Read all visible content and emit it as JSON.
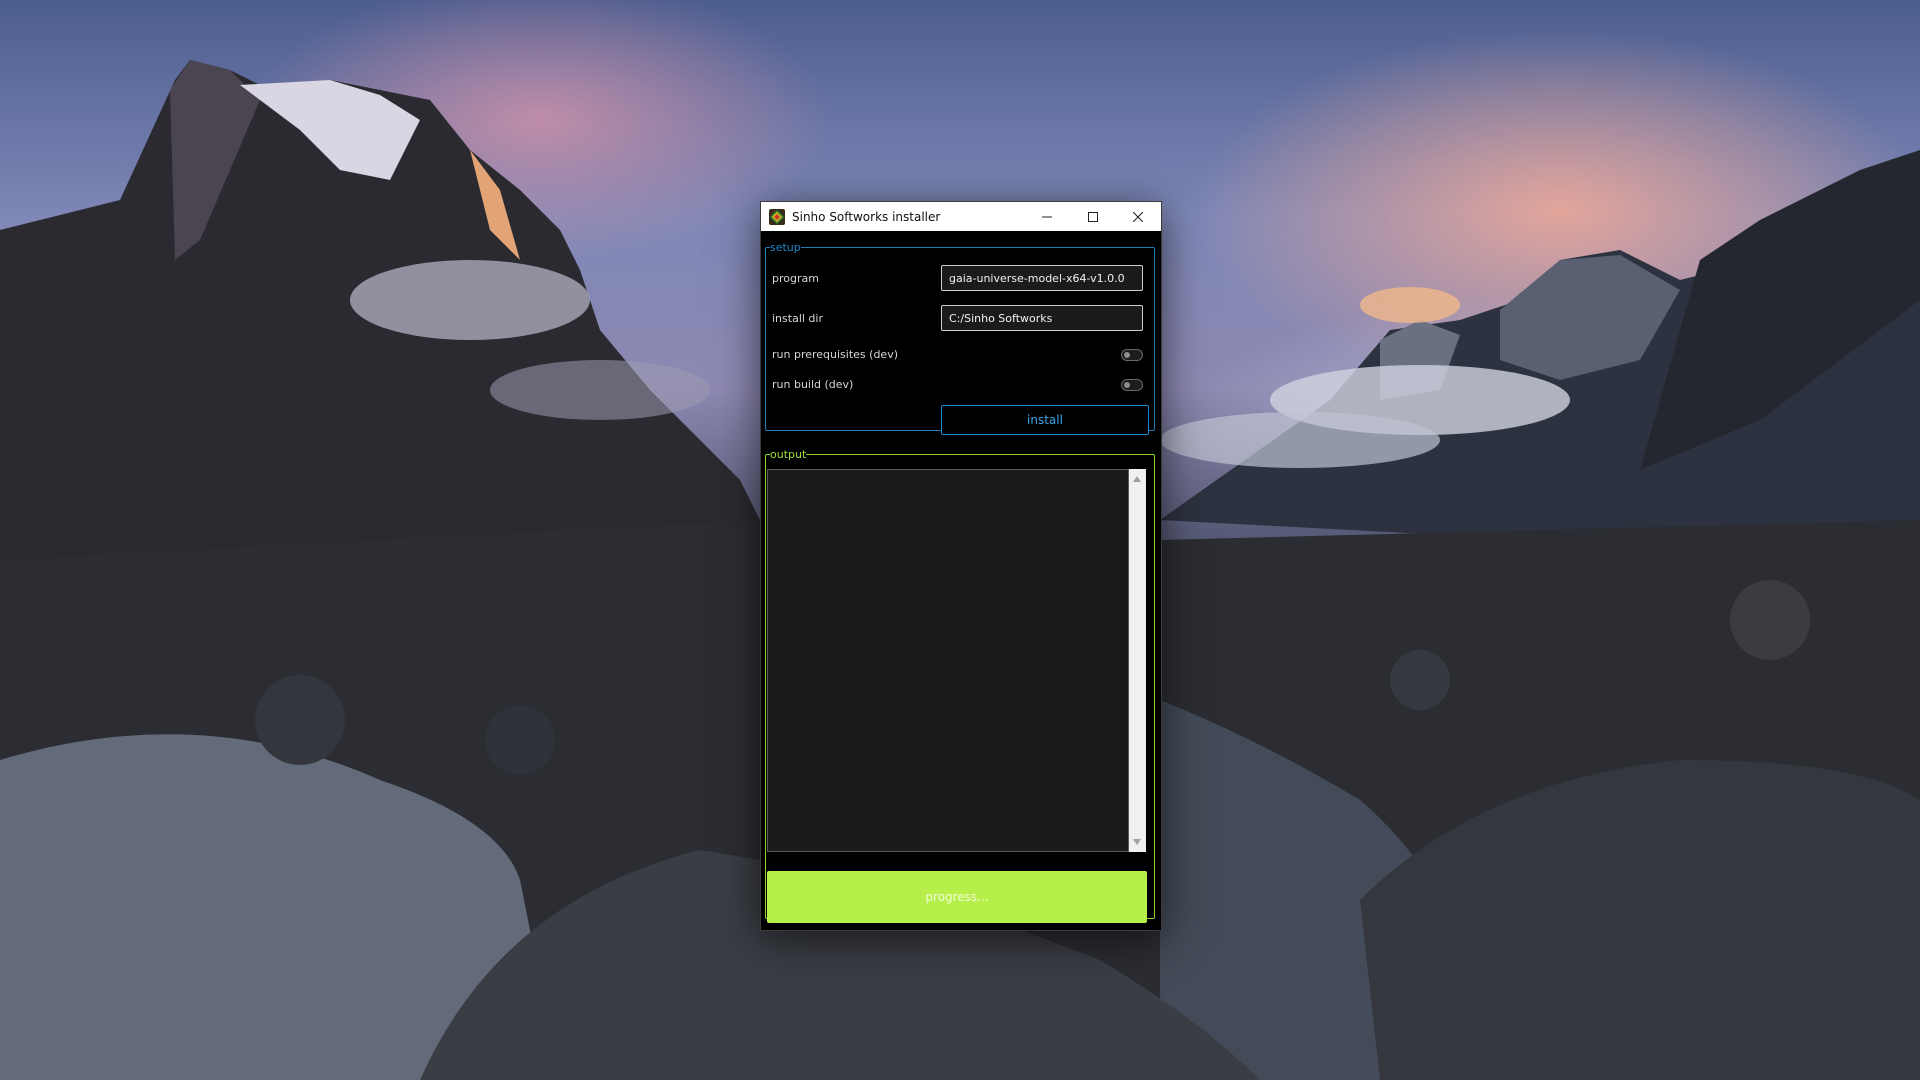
{
  "window": {
    "title": "Sinho Softworks installer",
    "minimize_icon": "minimize-icon",
    "maximize_icon": "maximize-icon",
    "close_icon": "close-icon"
  },
  "setup": {
    "legend": "setup",
    "program_label": "program",
    "program_value": "gaia-universe-model-x64-v1.0.0",
    "install_dir_label": "install dir",
    "install_dir_value": "C:/Sinho Softworks",
    "run_prerequisites_label": "run prerequisites (dev)",
    "run_prerequisites_on": false,
    "run_build_label": "run build (dev)",
    "run_build_on": false,
    "install_button": "install"
  },
  "output": {
    "legend": "output",
    "log_text": "",
    "progress_text": "progress..."
  },
  "colors": {
    "setup_accent": "#1e88c8",
    "output_accent": "#8bd12d",
    "progress_fill": "#b6ef4a"
  }
}
